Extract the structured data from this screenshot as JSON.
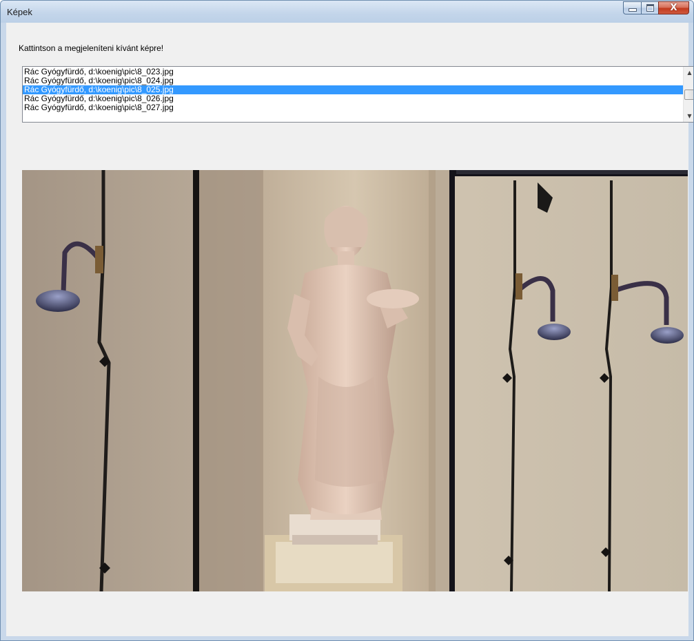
{
  "window": {
    "title": "Képek"
  },
  "controls": {
    "minimize_icon": "minimize-icon",
    "maximize_icon": "maximize-icon",
    "close_icon": "close-icon",
    "close_glyph": "X"
  },
  "prompt": "Kattintson a megjeleníteni kívánt képre!",
  "list": {
    "items": [
      "Rác Gyógyfürdő,  d:\\koenig\\pic\\8_023.jpg",
      "Rác Gyógyfürdő,  d:\\koenig\\pic\\8_024.jpg",
      "Rác Gyógyfürdő,  d:\\koenig\\pic\\8_025.jpg",
      "Rác Gyógyfürdő,  d:\\koenig\\pic\\8_026.jpg",
      "Rác Gyógyfürdő,  d:\\koenig\\pic\\8_027.jpg"
    ],
    "selected_index": 2
  },
  "colors": {
    "selection": "#3399ff",
    "client_bg": "#f0f0f0",
    "title_bar": "#c3d5ea",
    "close_button": "#c1391d"
  }
}
